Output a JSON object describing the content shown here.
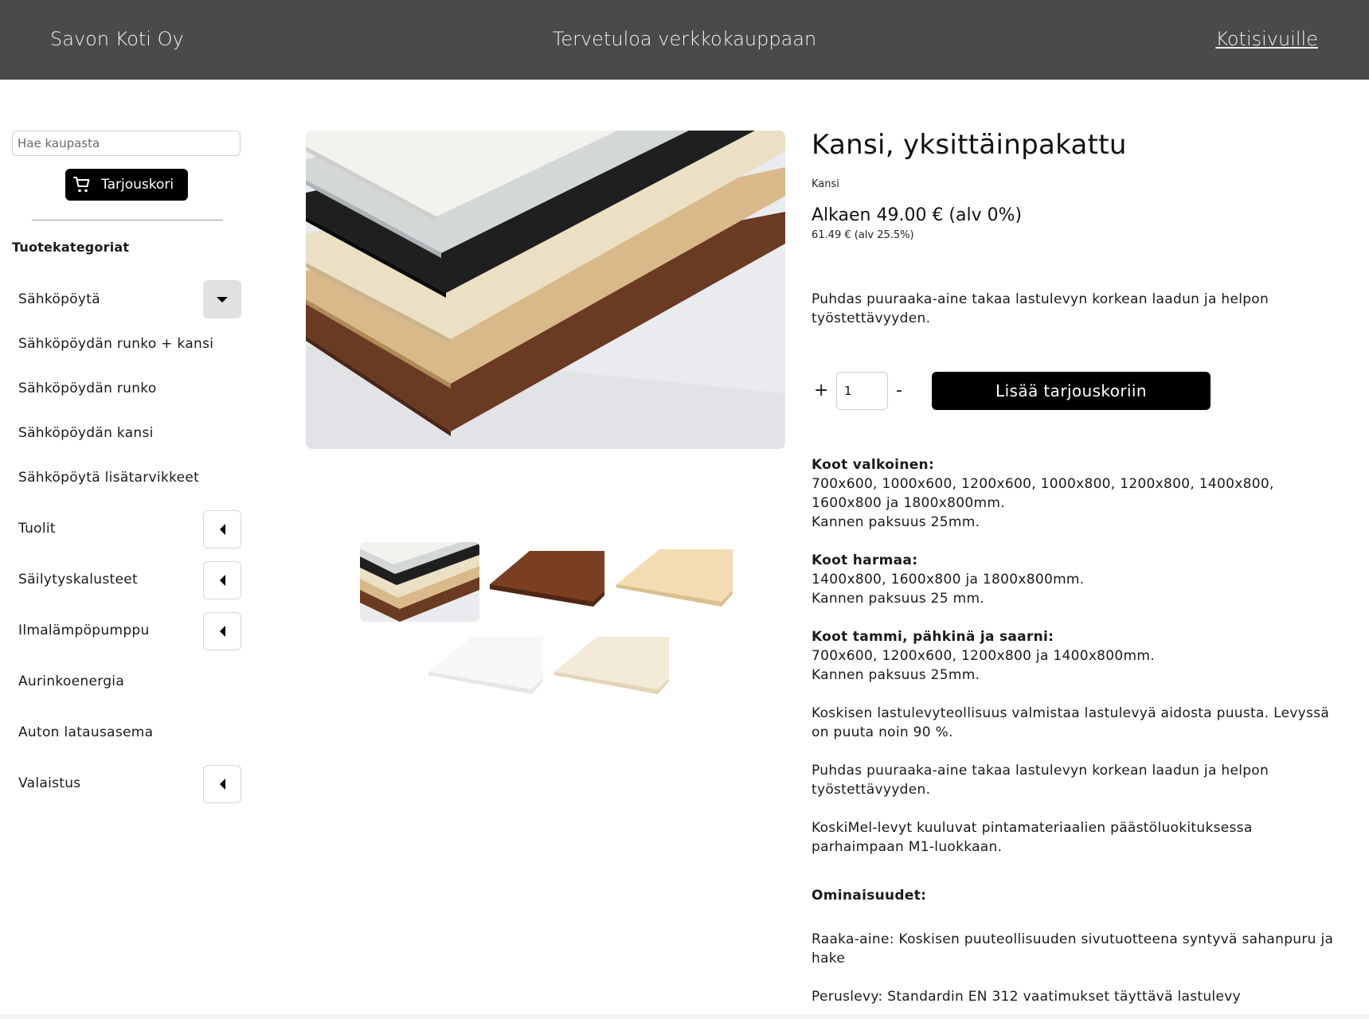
{
  "header": {
    "brand": "Savon Koti Oy",
    "welcome": "Tervetuloa verkkokauppaan",
    "home_link": "Kotisivuille"
  },
  "sidebar": {
    "search_placeholder": "Hae kaupasta",
    "cart_label": "Tarjouskori",
    "categories_heading": "Tuotekategoriat",
    "categories": [
      {
        "label": "Sähköpöytä",
        "toggle": "expanded"
      },
      {
        "label": "Sähköpöydän runko + kansi"
      },
      {
        "label": "Sähköpöydän runko"
      },
      {
        "label": "Sähköpöydän kansi"
      },
      {
        "label": "Sähköpöytä lisätarvikkeet"
      },
      {
        "label": "Tuolit",
        "toggle": "collapsed"
      },
      {
        "label": "Säilytyskalusteet",
        "toggle": "collapsed"
      },
      {
        "label": "Ilmalämpöpumppu",
        "toggle": "collapsed"
      },
      {
        "label": "Aurinkoenergia"
      },
      {
        "label": "Auton latausasema"
      },
      {
        "label": "Valaistus",
        "toggle": "collapsed"
      }
    ]
  },
  "product": {
    "title": "Kansi, yksittäinpakattu",
    "category": "Kansi",
    "price": "Alkaen 49.00 € (alv 0%)",
    "price_vat": "61.49 € (alv 25.5%)",
    "lead": "Puhdas puuraaka-aine takaa lastulevyn korkean laadun ja helpon työstettävyyden.",
    "qty_plus": "+",
    "qty_value": "1",
    "qty_minus": "-",
    "add_to_cart": "Lisää tarjouskoriin",
    "thumbnail_colors": [
      "stack",
      "#7a3f22",
      "#f2dcb2",
      "#f7f7f6",
      "#f3ead8"
    ]
  },
  "description": {
    "white_heading": "Koot valkoinen:",
    "white_sizes": "700x600, 1000x600, 1200x600, 1000x800, 1200x800, 1400x800, 1600x800 ja 1800x800mm.",
    "white_thickness": "Kannen paksuus 25mm.",
    "grey_heading": "Koot harmaa:",
    "grey_sizes": "1400x800, 1600x800 ja 1800x800mm.",
    "grey_thickness": "Kannen paksuus 25 mm.",
    "wood_heading": "Koot tammi, pähkinä ja saarni:",
    "wood_sizes": "700x600, 1200x600, 1200x800 ja 1400x800mm.",
    "wood_thickness": "Kannen paksuus 25mm.",
    "para1": "Koskisen lastulevyteollisuus valmistaa lastulevyä aidosta puusta. Levyssä on puuta noin 90 %.",
    "para2": "Puhdas puuraaka-aine takaa lastulevyn korkean laadun ja helpon työstettävyyden.",
    "para3": "KoskiMel-levyt kuuluvat pintamateriaalien päästöluokituksessa parhaimpaan M1-luokkaan.",
    "features_heading": "Ominaisuudet:",
    "feature1": "Raaka-aine: Koskisen puuteollisuuden sivutuotteena syntyvä sahanpuru ja hake",
    "feature2": "Peruslevy: Standardin EN 312 vaatimukset täyttävä lastulevy"
  }
}
